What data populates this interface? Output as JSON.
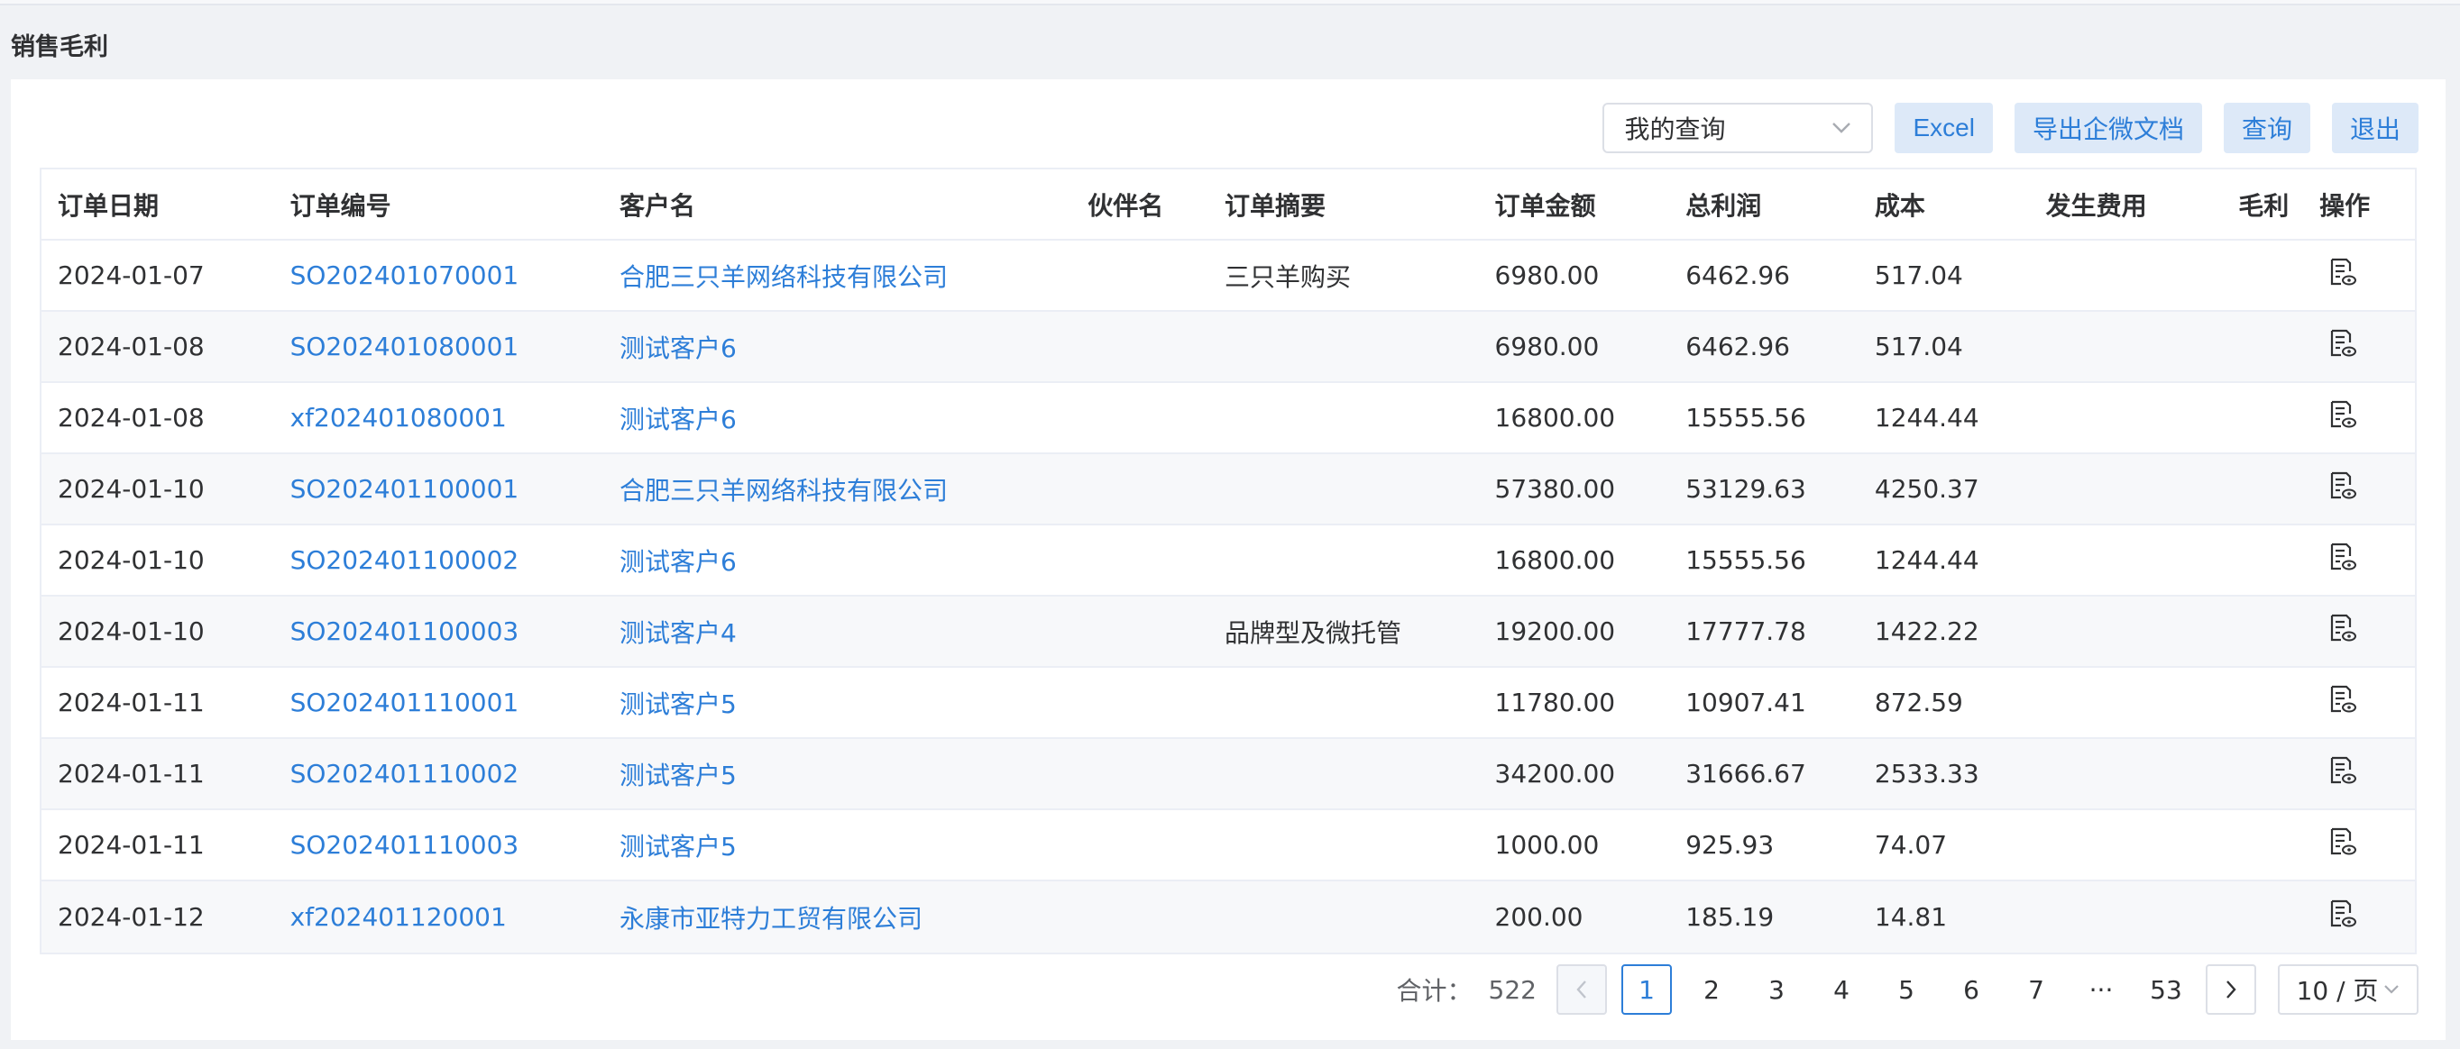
{
  "page": {
    "title": "销售毛利"
  },
  "toolbar": {
    "query_select": "我的查询",
    "excel": "Excel",
    "export_wecom": "导出企微文档",
    "query": "查询",
    "exit": "退出"
  },
  "table": {
    "columns": [
      "订单日期",
      "订单编号",
      "客户名",
      "伙伴名",
      "订单摘要",
      "订单金额",
      "总利润",
      "成本",
      "发生费用",
      "毛利",
      "操作"
    ],
    "rows": [
      {
        "date": "2024-01-07",
        "order_no": "SO202401070001",
        "customer": "合肥三只羊网络科技有限公司",
        "partner": "",
        "summary": "三只羊购买",
        "amount": "6980.00",
        "profit": "6462.96",
        "cost": "517.04",
        "expense": "",
        "margin": ""
      },
      {
        "date": "2024-01-08",
        "order_no": "SO202401080001",
        "customer": "测试客户6",
        "partner": "",
        "summary": "",
        "amount": "6980.00",
        "profit": "6462.96",
        "cost": "517.04",
        "expense": "",
        "margin": ""
      },
      {
        "date": "2024-01-08",
        "order_no": "xf202401080001",
        "customer": "测试客户6",
        "partner": "",
        "summary": "",
        "amount": "16800.00",
        "profit": "15555.56",
        "cost": "1244.44",
        "expense": "",
        "margin": ""
      },
      {
        "date": "2024-01-10",
        "order_no": "SO202401100001",
        "customer": "合肥三只羊网络科技有限公司",
        "partner": "",
        "summary": "",
        "amount": "57380.00",
        "profit": "53129.63",
        "cost": "4250.37",
        "expense": "",
        "margin": ""
      },
      {
        "date": "2024-01-10",
        "order_no": "SO202401100002",
        "customer": "测试客户6",
        "partner": "",
        "summary": "",
        "amount": "16800.00",
        "profit": "15555.56",
        "cost": "1244.44",
        "expense": "",
        "margin": ""
      },
      {
        "date": "2024-01-10",
        "order_no": "SO202401100003",
        "customer": "测试客户4",
        "partner": "",
        "summary": "品牌型及微托管",
        "amount": "19200.00",
        "profit": "17777.78",
        "cost": "1422.22",
        "expense": "",
        "margin": ""
      },
      {
        "date": "2024-01-11",
        "order_no": "SO202401110001",
        "customer": "测试客户5",
        "partner": "",
        "summary": "",
        "amount": "11780.00",
        "profit": "10907.41",
        "cost": "872.59",
        "expense": "",
        "margin": ""
      },
      {
        "date": "2024-01-11",
        "order_no": "SO202401110002",
        "customer": "测试客户5",
        "partner": "",
        "summary": "",
        "amount": "34200.00",
        "profit": "31666.67",
        "cost": "2533.33",
        "expense": "",
        "margin": ""
      },
      {
        "date": "2024-01-11",
        "order_no": "SO202401110003",
        "customer": "测试客户5",
        "partner": "",
        "summary": "",
        "amount": "1000.00",
        "profit": "925.93",
        "cost": "74.07",
        "expense": "",
        "margin": ""
      },
      {
        "date": "2024-01-12",
        "order_no": "xf202401120001",
        "customer": "永康市亚特力工贸有限公司",
        "partner": "",
        "summary": "",
        "amount": "200.00",
        "profit": "185.19",
        "cost": "14.81",
        "expense": "",
        "margin": ""
      }
    ],
    "op_icon": "document-view-icon"
  },
  "pagination": {
    "total_label": "合计：",
    "total": "522",
    "pages": [
      "1",
      "2",
      "3",
      "4",
      "5",
      "6",
      "7",
      "···",
      "53"
    ],
    "active_page": "1",
    "page_size": "10 / 页"
  },
  "colors": {
    "link": "#2d7ed8",
    "button_bg": "#dde9f8",
    "stripe": "#f7f8fa"
  }
}
